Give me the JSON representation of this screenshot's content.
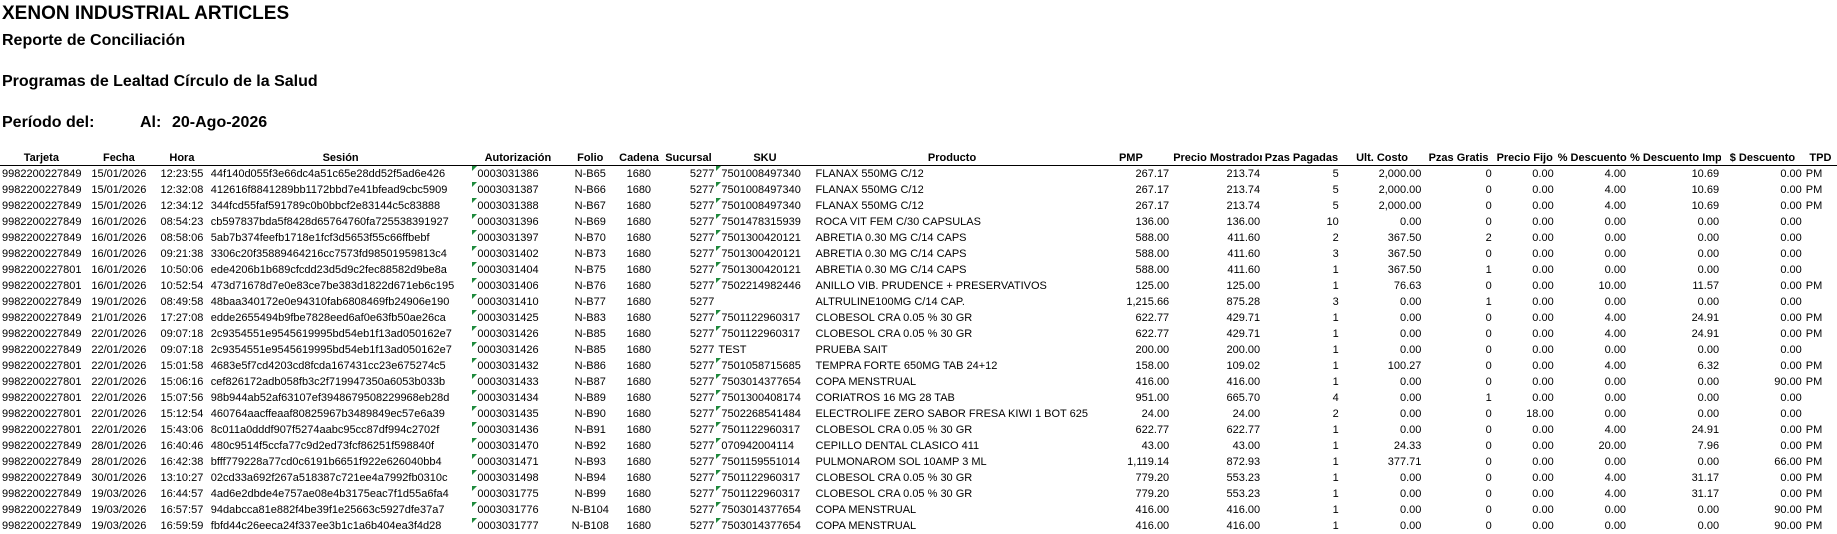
{
  "report": {
    "company": "XENON INDUSTRIAL ARTICLES",
    "subtitle": "Reporte de Conciliación",
    "program": "Programas de Lealtad Círculo de la Salud",
    "period_label": "Período del:",
    "to_label": "Al:",
    "to_date": "20-Ago-2026"
  },
  "table": {
    "columns": [
      "Tarjeta",
      "Fecha",
      "Hora",
      "Sesión",
      "Autorización",
      "Folio",
      "Cadena",
      "Sucursal",
      "SKU",
      "Producto",
      "PMP",
      "Precio Mostrador",
      "Pzas Pagadas",
      "Ult. Costo",
      "Pzas Gratis",
      "Precio Fijo",
      "% Descuento",
      "% Descuento Imp.",
      "$ Descuento",
      "TPD"
    ],
    "rows": [
      [
        "9982200227849",
        "15/01/2026",
        "12:23:55",
        "44f140d055f3e66dc4a51c65e28dd52f5ad6e426",
        "0003031386",
        "N-B65",
        "1680",
        "5277",
        "7501008497340",
        "FLANAX 550MG C/12",
        "267.17",
        "213.74",
        "5",
        "2,000.00",
        "0",
        "0.00",
        "4.00",
        "10.69",
        "0.00",
        "PM"
      ],
      [
        "9982200227849",
        "15/01/2026",
        "12:32:08",
        "412616f8841289bb1172bbd7e41bfead9cbc5909",
        "0003031387",
        "N-B66",
        "1680",
        "5277",
        "7501008497340",
        "FLANAX 550MG C/12",
        "267.17",
        "213.74",
        "5",
        "2,000.00",
        "0",
        "0.00",
        "4.00",
        "10.69",
        "0.00",
        "PM"
      ],
      [
        "9982200227849",
        "15/01/2026",
        "12:34:12",
        "344fcd55faf591789c0b0bbcf2e83144c5c83888",
        "0003031388",
        "N-B67",
        "1680",
        "5277",
        "7501008497340",
        "FLANAX 550MG C/12",
        "267.17",
        "213.74",
        "5",
        "2,000.00",
        "0",
        "0.00",
        "4.00",
        "10.69",
        "0.00",
        "PM"
      ],
      [
        "9982200227849",
        "16/01/2026",
        "08:54:23",
        "cb597837bda5f8428d65764760fa725538391927",
        "0003031396",
        "N-B69",
        "1680",
        "5277",
        "7501478315939",
        "ROCA VIT FEM C/30 CAPSULAS",
        "136.00",
        "136.00",
        "10",
        "0.00",
        "0",
        "0.00",
        "0.00",
        "0.00",
        "0.00",
        ""
      ],
      [
        "9982200227849",
        "16/01/2026",
        "08:58:06",
        "5ab7b374feefb1718e1fcf3d5653f55c66ffbebf",
        "0003031397",
        "N-B70",
        "1680",
        "5277",
        "7501300420121",
        "ABRETIA 0.30 MG C/14 CAPS",
        "588.00",
        "411.60",
        "2",
        "367.50",
        "2",
        "0.00",
        "0.00",
        "0.00",
        "0.00",
        ""
      ],
      [
        "9982200227849",
        "16/01/2026",
        "09:21:38",
        "3306c20f35889464216cc7573fd98501959813c4",
        "0003031402",
        "N-B73",
        "1680",
        "5277",
        "7501300420121",
        "ABRETIA 0.30 MG C/14 CAPS",
        "588.00",
        "411.60",
        "3",
        "367.50",
        "0",
        "0.00",
        "0.00",
        "0.00",
        "0.00",
        ""
      ],
      [
        "9982200227801",
        "16/01/2026",
        "10:50:06",
        "ede4206b1b689cfcdd23d5d9c2fec88582d9be8a",
        "0003031404",
        "N-B75",
        "1680",
        "5277",
        "7501300420121",
        "ABRETIA 0.30 MG C/14 CAPS",
        "588.00",
        "411.60",
        "1",
        "367.50",
        "1",
        "0.00",
        "0.00",
        "0.00",
        "0.00",
        ""
      ],
      [
        "9982200227801",
        "16/01/2026",
        "10:52:54",
        "473d71678d7e0e83ce7be383d1822d671eb6c195",
        "0003031406",
        "N-B76",
        "1680",
        "5277",
        "7502214982446",
        "ANILLO VIB. PRUDENCE + PRESERVATIVOS",
        "125.00",
        "125.00",
        "1",
        "76.63",
        "0",
        "0.00",
        "10.00",
        "11.57",
        "0.00",
        "PM"
      ],
      [
        "9982200227849",
        "19/01/2026",
        "08:49:58",
        "48baa340172e0e94310fab6808469fb24906e190",
        "0003031410",
        "N-B77",
        "1680",
        "5277",
        "",
        "ALTRULINE100MG C/14 CAP.",
        "1,215.66",
        "875.28",
        "3",
        "0.00",
        "1",
        "0.00",
        "0.00",
        "0.00",
        "0.00",
        ""
      ],
      [
        "9982200227849",
        "21/01/2026",
        "17:27:08",
        "edde2655494b9fbe7828eed6af0e63fb50ae26ca",
        "0003031425",
        "N-B83",
        "1680",
        "5277",
        "7501122960317",
        "CLOBESOL CRA 0.05 % 30 GR",
        "622.77",
        "429.71",
        "1",
        "0.00",
        "0",
        "0.00",
        "4.00",
        "24.91",
        "0.00",
        "PM"
      ],
      [
        "9982200227849",
        "22/01/2026",
        "09:07:18",
        "2c9354551e9545619995bd54eb1f13ad050162e7",
        "0003031426",
        "N-B85",
        "1680",
        "5277",
        "7501122960317",
        "CLOBESOL CRA 0.05 % 30 GR",
        "622.77",
        "429.71",
        "1",
        "0.00",
        "0",
        "0.00",
        "4.00",
        "24.91",
        "0.00",
        "PM"
      ],
      [
        "9982200227849",
        "22/01/2026",
        "09:07:18",
        "2c9354551e9545619995bd54eb1f13ad050162e7",
        "0003031426",
        "N-B85",
        "1680",
        "5277",
        "TEST",
        "PRUEBA SAIT",
        "200.00",
        "200.00",
        "1",
        "0.00",
        "0",
        "0.00",
        "0.00",
        "0.00",
        "0.00",
        ""
      ],
      [
        "9982200227801",
        "22/01/2026",
        "15:01:58",
        "4683e5f7cd4203cd8fcda167431cc23e675274c5",
        "0003031432",
        "N-B86",
        "1680",
        "5277",
        "7501058715685",
        "TEMPRA FORTE 650MG TAB 24+12",
        "158.00",
        "109.02",
        "1",
        "100.27",
        "0",
        "0.00",
        "4.00",
        "6.32",
        "0.00",
        "PM"
      ],
      [
        "9982200227801",
        "22/01/2026",
        "15:06:16",
        "cef826172adb058fb3c2f719947350a6053b033b",
        "0003031433",
        "N-B87",
        "1680",
        "5277",
        "7503014377654",
        "COPA MENSTRUAL",
        "416.00",
        "416.00",
        "1",
        "0.00",
        "0",
        "0.00",
        "0.00",
        "0.00",
        "90.00",
        "PM"
      ],
      [
        "9982200227801",
        "22/01/2026",
        "15:07:56",
        "98b944ab52af63107ef3948679508229968eb28d",
        "0003031434",
        "N-B89",
        "1680",
        "5277",
        "7501300408174",
        "CORIATROS 16 MG 28 TAB",
        "951.00",
        "665.70",
        "4",
        "0.00",
        "1",
        "0.00",
        "0.00",
        "0.00",
        "0.00",
        ""
      ],
      [
        "9982200227801",
        "22/01/2026",
        "15:12:54",
        "460764aacffeaaf80825967b3489849ec57e6a39",
        "0003031435",
        "N-B90",
        "1680",
        "5277",
        "7502268541484",
        "ELECTROLIFE ZERO SABOR FRESA KIWI 1 BOT 625 ml",
        "24.00",
        "24.00",
        "2",
        "0.00",
        "0",
        "18.00",
        "0.00",
        "0.00",
        "0.00",
        ""
      ],
      [
        "9982200227801",
        "22/01/2026",
        "15:43:06",
        "8c011a0dddf907f5274aabc95cc87df994c2702f",
        "0003031436",
        "N-B91",
        "1680",
        "5277",
        "7501122960317",
        "CLOBESOL CRA 0.05 % 30 GR",
        "622.77",
        "622.77",
        "1",
        "0.00",
        "0",
        "0.00",
        "4.00",
        "24.91",
        "0.00",
        "PM"
      ],
      [
        "9982200227849",
        "28/01/2026",
        "16:40:46",
        "480c9514f5ccfa77c9d2ed73fcf86251f598840f",
        "0003031470",
        "N-B92",
        "1680",
        "5277",
        "070942004114",
        "CEPILLO DENTAL CLASICO 411",
        "43.00",
        "43.00",
        "1",
        "24.33",
        "0",
        "0.00",
        "20.00",
        "7.96",
        "0.00",
        "PM"
      ],
      [
        "9982200227849",
        "28/01/2026",
        "16:42:38",
        "bfff779228a77cd0c6191b6651f922e626040bb4",
        "0003031471",
        "N-B93",
        "1680",
        "5277",
        "7501159551014",
        "PULMONAROM SOL 10AMP 3 ML",
        "1,119.14",
        "872.93",
        "1",
        "377.71",
        "0",
        "0.00",
        "0.00",
        "0.00",
        "66.00",
        "PM"
      ],
      [
        "9982200227849",
        "30/01/2026",
        "13:10:27",
        "02cd33a692f267a518387c721ee4a7992fb0310c",
        "0003031498",
        "N-B94",
        "1680",
        "5277",
        "7501122960317",
        "CLOBESOL CRA 0.05 % 30 GR",
        "779.20",
        "553.23",
        "1",
        "0.00",
        "0",
        "0.00",
        "4.00",
        "31.17",
        "0.00",
        "PM"
      ],
      [
        "9982200227849",
        "19/03/2026",
        "16:44:57",
        "4ad6e2dbde4e757ae08e4b3175eac7f1d55a6fa4",
        "0003031775",
        "N-B99",
        "1680",
        "5277",
        "7501122960317",
        "CLOBESOL CRA 0.05 % 30 GR",
        "779.20",
        "553.23",
        "1",
        "0.00",
        "0",
        "0.00",
        "4.00",
        "31.17",
        "0.00",
        "PM"
      ],
      [
        "9982200227849",
        "19/03/2026",
        "16:57:57",
        "94dabcca81e882f4be39f1e25663c5927dfe37a7",
        "0003031776",
        "N-B104",
        "1680",
        "5277",
        "7503014377654",
        "COPA MENSTRUAL",
        "416.00",
        "416.00",
        "1",
        "0.00",
        "0",
        "0.00",
        "0.00",
        "0.00",
        "90.00",
        "PM"
      ],
      [
        "9982200227849",
        "19/03/2026",
        "16:59:59",
        "fbfd44c26eeca24f337ee3b1c1a6b404ea3f4d28",
        "0003031777",
        "N-B108",
        "1680",
        "5277",
        "7503014377654",
        "COPA MENSTRUAL",
        "416.00",
        "416.00",
        "1",
        "0.00",
        "0",
        "0.00",
        "0.00",
        "0.00",
        "90.00",
        "PM"
      ]
    ]
  }
}
